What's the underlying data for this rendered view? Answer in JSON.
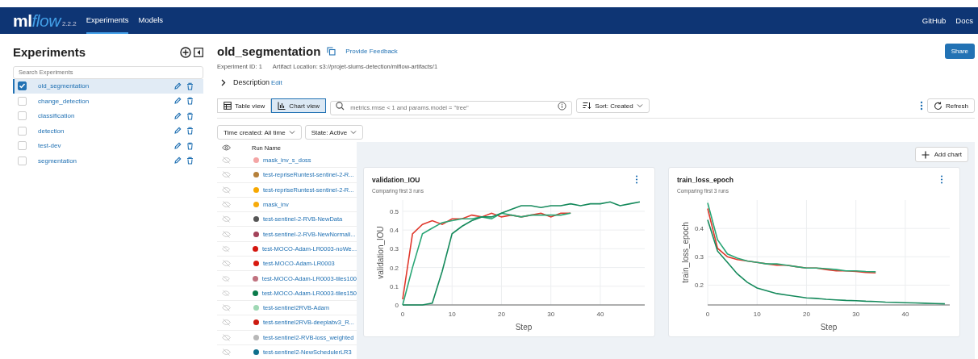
{
  "header": {
    "logo": "ml",
    "logo_accent": "flow",
    "version": "2.2.2",
    "nav": [
      {
        "label": "Experiments",
        "selected": true
      },
      {
        "label": "Models",
        "selected": false
      }
    ],
    "links": [
      "GitHub",
      "Docs"
    ]
  },
  "sidebar": {
    "title": "Experiments",
    "search": {
      "placeholder": "Search Experiments"
    },
    "items": [
      {
        "name": "old_segmentation",
        "checked": true,
        "selected": true
      },
      {
        "name": "change_detection",
        "checked": false,
        "selected": false
      },
      {
        "name": "classification",
        "checked": false,
        "selected": false
      },
      {
        "name": "detection",
        "checked": false,
        "selected": false
      },
      {
        "name": "test-dev",
        "checked": false,
        "selected": false
      },
      {
        "name": "segmentation",
        "checked": false,
        "selected": false
      }
    ]
  },
  "experiment": {
    "title": "old_segmentation",
    "feedback_link": "Provide Feedback",
    "share_button": "Share",
    "id": "Experiment ID: 1",
    "artifact": "Artifact Location: s3://projet-slums-detection/mlflow-artifacts/1",
    "description": "Description",
    "edit_link": "Edit"
  },
  "toolbar": {
    "views": [
      {
        "label": "Table view",
        "selected": false
      },
      {
        "label": "Chart view",
        "selected": true
      }
    ],
    "search": {
      "placeholder": "metrics.rmse < 1 and params.model = \"tree\""
    },
    "sort": "Sort: Created",
    "refresh": "Refresh"
  },
  "filters": [
    "Time created: All time",
    "State: Active"
  ],
  "runs": {
    "column": "Run Name",
    "rows": [
      {
        "name": "mask_inv_s_doss",
        "color": "#f4a5a5"
      },
      {
        "name": "test-repriseRuntest-sentinel-2-R...",
        "color": "#b5803a"
      },
      {
        "name": "test-repriseRuntest-sentinel-2-R...",
        "color": "#f7a800"
      },
      {
        "name": "mask_inv",
        "color": "#f7ab0a"
      },
      {
        "name": "test-sentinel-2-RVB-NewData",
        "color": "#555555"
      },
      {
        "name": "test-sentinel-2-RVB-NewNormali...",
        "color": "#a3425a"
      },
      {
        "name": "test-MOCO-Adam-LR0003-noWe...",
        "color": "#d4160e"
      },
      {
        "name": "test-MOCO-Adam-LR0003",
        "color": "#d8190f"
      },
      {
        "name": "test-MOCO-Adam-LR0003-tiles100",
        "color": "#c0727f"
      },
      {
        "name": "test-MOCO-Adam-LR0003-tiles150",
        "color": "#0a7a4a"
      },
      {
        "name": "test-sentinel2RVB-Adam",
        "color": "#9fd8b4"
      },
      {
        "name": "test-sentinel2RVB-deeplabv3_R...",
        "color": "#cc1a10"
      },
      {
        "name": "test-sentinel2-RVB-loss_weighted",
        "color": "#b8b8b8"
      },
      {
        "name": "test-sentinel2-NewSchedulerLR3",
        "color": "#0e6f8c"
      }
    ]
  },
  "add_chart": "Add chart",
  "charts": [
    {
      "title": "validation_IOU",
      "subtitle": "Comparing first 3 runs",
      "chart_data": {
        "type": "line",
        "grid": true,
        "xlabel": "Step",
        "ylabel": "validation_IOU",
        "xlim": [
          0,
          49
        ],
        "ylim": [
          0,
          0.56
        ],
        "xticks": [
          0,
          10,
          20,
          30,
          40
        ],
        "yticks": [
          0,
          0.1,
          0.2,
          0.3,
          0.4,
          0.5
        ],
        "x": [
          0,
          2,
          4,
          6,
          8,
          10,
          12,
          14,
          16,
          18,
          20,
          22,
          24,
          26,
          28,
          30,
          32,
          34,
          36,
          38,
          40,
          42,
          44,
          46,
          48
        ],
        "series": [
          {
            "color": "#e0382c",
            "values": [
              0.03,
              0.38,
              0.43,
              0.45,
              0.43,
              0.46,
              0.46,
              0.48,
              0.47,
              0.49,
              0.47,
              0.48,
              0.47,
              0.48,
              0.49,
              0.47,
              0.49,
              0.49,
              null,
              null,
              null,
              null,
              null,
              null,
              null
            ]
          },
          {
            "color": "#2aa676",
            "values": [
              0,
              0.2,
              0.38,
              0.41,
              0.44,
              0.45,
              0.46,
              0.46,
              0.47,
              0.46,
              0.49,
              0.48,
              0.47,
              0.48,
              0.48,
              0.48,
              0.48,
              0.49,
              null,
              null,
              null,
              null,
              null,
              null,
              null
            ]
          },
          {
            "color": "#168a5c",
            "values": [
              0,
              0,
              0,
              0.01,
              0.18,
              0.38,
              0.42,
              0.45,
              0.47,
              0.47,
              0.49,
              0.51,
              0.53,
              0.53,
              0.52,
              0.53,
              0.53,
              0.54,
              0.53,
              0.54,
              0.54,
              0.55,
              0.53,
              0.54,
              0.55
            ]
          }
        ]
      }
    },
    {
      "title": "train_loss_epoch",
      "subtitle": "Comparing first 3 runs",
      "chart_data": {
        "type": "line",
        "grid": true,
        "xlabel": "Step",
        "ylabel": "train_loss_epoch",
        "xlim": [
          0,
          49
        ],
        "ylim": [
          0.13,
          0.5
        ],
        "xticks": [
          0,
          10,
          20,
          30,
          40
        ],
        "yticks": [
          0.2,
          0.3,
          0.4
        ],
        "x": [
          0,
          2,
          4,
          6,
          8,
          10,
          12,
          14,
          16,
          18,
          20,
          22,
          24,
          26,
          28,
          30,
          32,
          34,
          36,
          38,
          40,
          42,
          44,
          46,
          48
        ],
        "series": [
          {
            "color": "#e0382c",
            "values": [
              0.47,
              0.33,
              0.3,
              0.29,
              0.285,
              0.28,
              0.275,
              0.27,
              0.27,
              0.265,
              0.26,
              0.26,
              0.255,
              0.25,
              0.25,
              0.248,
              0.245,
              0.243,
              null,
              null,
              null,
              null,
              null,
              null,
              null
            ]
          },
          {
            "color": "#2aa676",
            "values": [
              0.49,
              0.36,
              0.31,
              0.295,
              0.285,
              0.28,
              0.275,
              0.275,
              0.27,
              0.265,
              0.26,
              0.26,
              0.258,
              0.255,
              0.25,
              0.25,
              0.248,
              0.247,
              null,
              null,
              null,
              null,
              null,
              null,
              null
            ]
          },
          {
            "color": "#168a5c",
            "values": [
              0.43,
              0.32,
              0.28,
              0.24,
              0.21,
              0.19,
              0.18,
              0.17,
              0.165,
              0.16,
              0.155,
              0.153,
              0.15,
              0.148,
              0.146,
              0.145,
              0.143,
              0.142,
              0.14,
              0.139,
              0.138,
              0.137,
              0.136,
              0.135,
              0.134
            ]
          }
        ]
      }
    }
  ]
}
